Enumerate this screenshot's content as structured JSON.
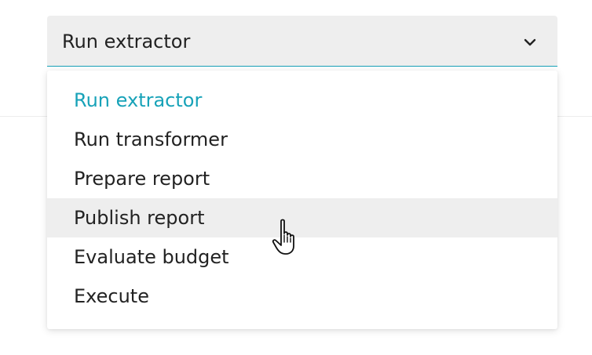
{
  "select": {
    "value": "Run extractor",
    "icon": "chevron-down-icon",
    "accent_color": "#17a2b8"
  },
  "menu": {
    "options": [
      {
        "label": "Run extractor",
        "state": "selected"
      },
      {
        "label": "Run transformer",
        "state": "normal"
      },
      {
        "label": "Prepare report",
        "state": "normal"
      },
      {
        "label": "Publish report",
        "state": "hovered"
      },
      {
        "label": "Evaluate budget",
        "state": "normal"
      },
      {
        "label": "Execute",
        "state": "normal"
      }
    ]
  },
  "pointer": {
    "icon": "hand-pointer-icon"
  }
}
